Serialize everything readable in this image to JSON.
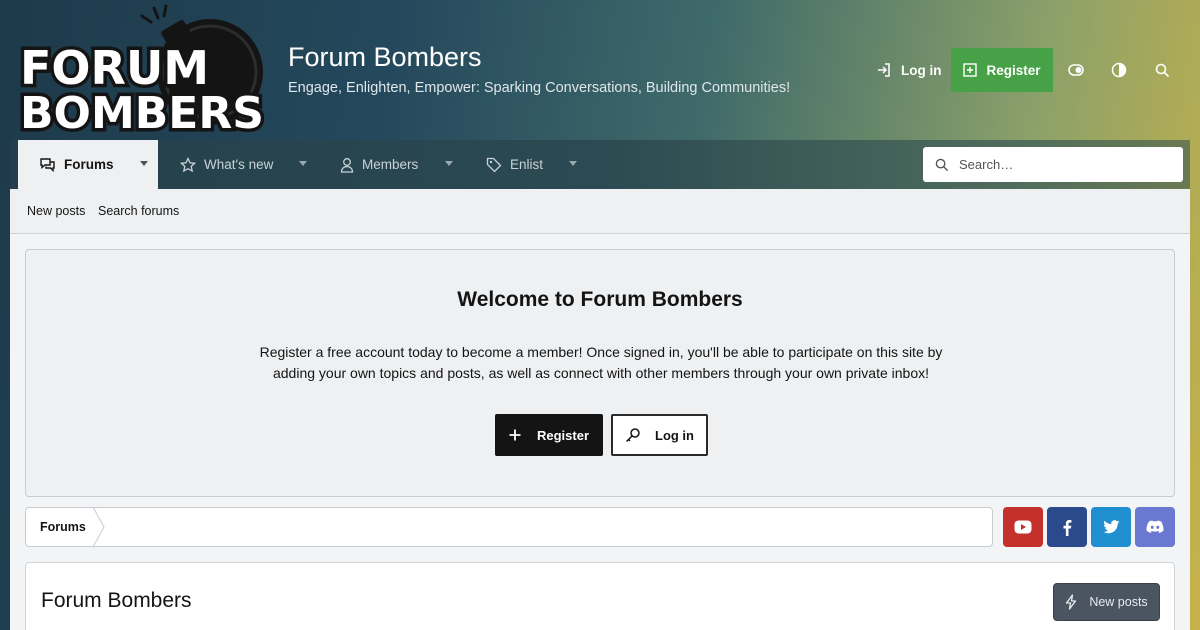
{
  "header": {
    "logo_line1": "FORUM",
    "logo_line2": "BOMBERS",
    "site_title": "Forum Bombers",
    "tagline": "Engage, Enlighten, Empower: Sparking Conversations, Building Communities!",
    "login_label": "Log in",
    "register_label": "Register",
    "icons": [
      "login-icon",
      "register-plus-icon",
      "style-toggle-icon",
      "contrast-icon",
      "search-icon"
    ]
  },
  "nav": {
    "tabs": [
      {
        "label": "Forums",
        "icon": "comments-icon",
        "active": true
      },
      {
        "label": "What's new",
        "icon": "star-icon",
        "active": false
      },
      {
        "label": "Members",
        "icon": "user-icon",
        "active": false
      },
      {
        "label": "Enlist",
        "icon": "tag-icon",
        "active": false
      }
    ],
    "search_placeholder": "Search…"
  },
  "subnav": {
    "items": [
      "New posts",
      "Search forums"
    ]
  },
  "welcome": {
    "title": "Welcome to Forum Bombers",
    "body": "Register a free account today to become a member! Once signed in, you'll be able to participate on this site by adding your own topics and posts, as well as connect with other members through your own private inbox!",
    "register_label": "Register",
    "login_label": "Log in"
  },
  "breadcrumb": {
    "items": [
      "Forums"
    ]
  },
  "social": [
    {
      "name": "youtube",
      "color": "#c4302b"
    },
    {
      "name": "facebook",
      "color": "#2a4a8c"
    },
    {
      "name": "twitter",
      "color": "#1f8fd0"
    },
    {
      "name": "discord",
      "color": "#6a78d1"
    }
  ],
  "forum_block": {
    "title": "Forum Bombers",
    "new_posts_label": "New posts"
  },
  "colors": {
    "register_green": "#47a147",
    "dark_button": "#141414",
    "new_posts_button": "#4a5561"
  }
}
